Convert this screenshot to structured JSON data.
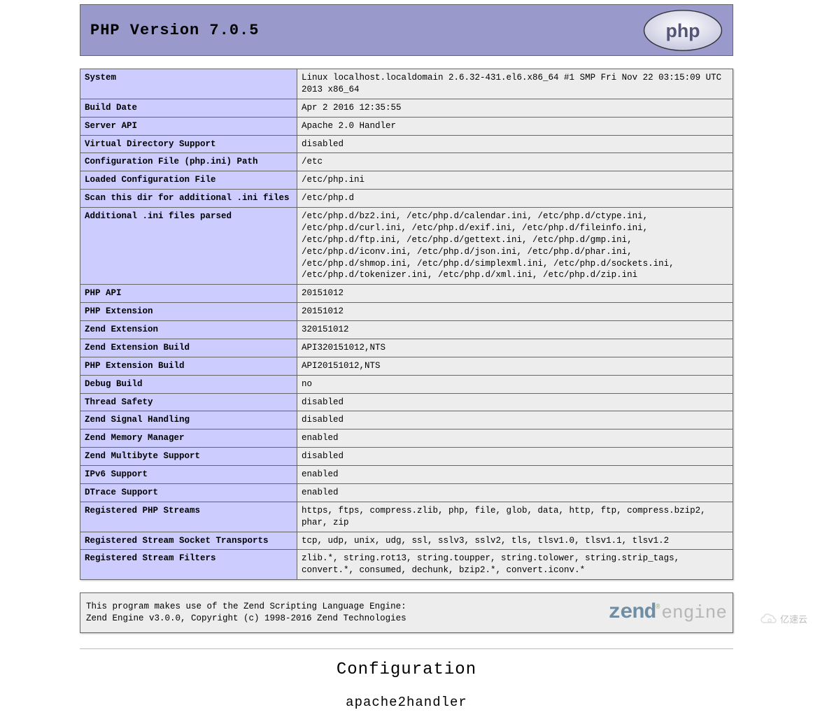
{
  "header": {
    "title": "PHP Version 7.0.5",
    "logo_text": "php"
  },
  "info_rows": [
    {
      "key": "System",
      "val": "Linux localhost.localdomain 2.6.32-431.el6.x86_64 #1 SMP Fri Nov 22 03:15:09 UTC 2013 x86_64"
    },
    {
      "key": "Build Date",
      "val": "Apr 2 2016 12:35:55"
    },
    {
      "key": "Server API",
      "val": "Apache 2.0 Handler"
    },
    {
      "key": "Virtual Directory Support",
      "val": "disabled"
    },
    {
      "key": "Configuration File (php.ini) Path",
      "val": "/etc"
    },
    {
      "key": "Loaded Configuration File",
      "val": "/etc/php.ini"
    },
    {
      "key": "Scan this dir for additional .ini files",
      "val": "/etc/php.d"
    },
    {
      "key": "Additional .ini files parsed",
      "val": "/etc/php.d/bz2.ini, /etc/php.d/calendar.ini, /etc/php.d/ctype.ini, /etc/php.d/curl.ini, /etc/php.d/exif.ini, /etc/php.d/fileinfo.ini, /etc/php.d/ftp.ini, /etc/php.d/gettext.ini, /etc/php.d/gmp.ini, /etc/php.d/iconv.ini, /etc/php.d/json.ini, /etc/php.d/phar.ini, /etc/php.d/shmop.ini, /etc/php.d/simplexml.ini, /etc/php.d/sockets.ini, /etc/php.d/tokenizer.ini, /etc/php.d/xml.ini, /etc/php.d/zip.ini"
    },
    {
      "key": "PHP API",
      "val": "20151012"
    },
    {
      "key": "PHP Extension",
      "val": "20151012"
    },
    {
      "key": "Zend Extension",
      "val": "320151012"
    },
    {
      "key": "Zend Extension Build",
      "val": "API320151012,NTS"
    },
    {
      "key": "PHP Extension Build",
      "val": "API20151012,NTS"
    },
    {
      "key": "Debug Build",
      "val": "no"
    },
    {
      "key": "Thread Safety",
      "val": "disabled"
    },
    {
      "key": "Zend Signal Handling",
      "val": "disabled"
    },
    {
      "key": "Zend Memory Manager",
      "val": "enabled"
    },
    {
      "key": "Zend Multibyte Support",
      "val": "disabled"
    },
    {
      "key": "IPv6 Support",
      "val": "enabled"
    },
    {
      "key": "DTrace Support",
      "val": "enabled"
    },
    {
      "key": "Registered PHP Streams",
      "val": "https, ftps, compress.zlib, php, file, glob, data, http, ftp, compress.bzip2, phar, zip"
    },
    {
      "key": "Registered Stream Socket Transports",
      "val": "tcp, udp, unix, udg, ssl, sslv3, sslv2, tls, tlsv1.0, tlsv1.1, tlsv1.2"
    },
    {
      "key": "Registered Stream Filters",
      "val": "zlib.*, string.rot13, string.toupper, string.tolower, string.strip_tags, convert.*, consumed, dechunk, bzip2.*, convert.iconv.*"
    }
  ],
  "zend": {
    "line1": "This program makes use of the Zend Scripting Language Engine:",
    "line2": "Zend  Engine  v3.0.0,  Copyright  (c)  1998-2016  Zend  Technologies",
    "logo_zend": "zend",
    "logo_engine": "engine"
  },
  "section": {
    "configuration": "Configuration",
    "apache2handler": "apache2handler"
  },
  "watermark": "亿速云"
}
